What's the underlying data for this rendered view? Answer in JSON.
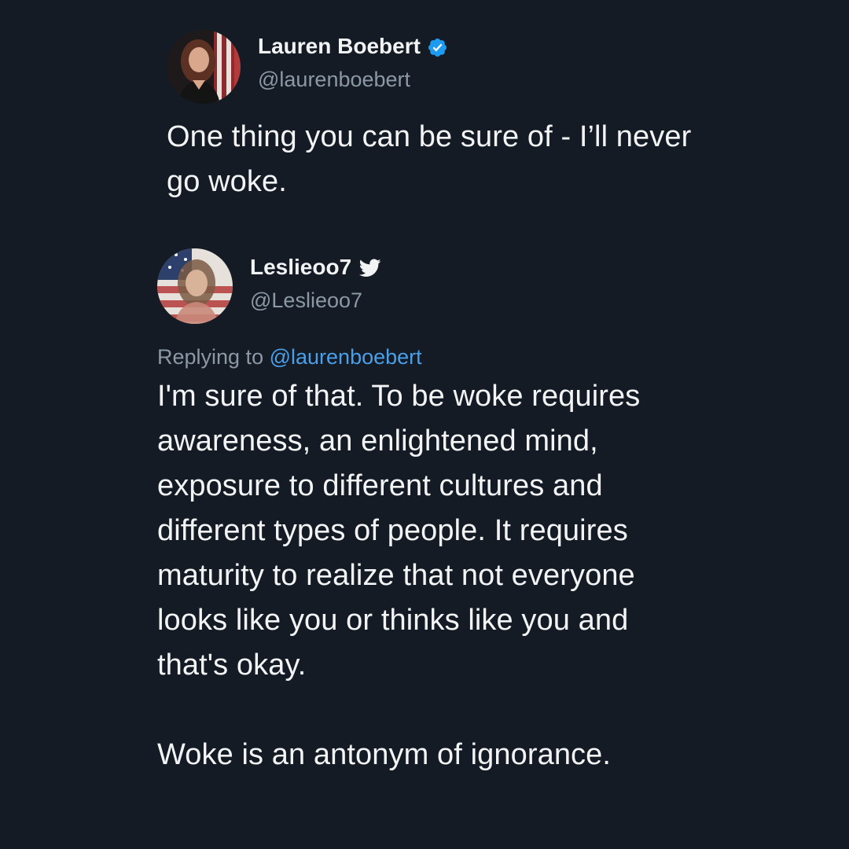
{
  "tweet_original": {
    "display_name": "Lauren Boebert",
    "handle": "@laurenboebert",
    "verified_icon": "verified-badge-icon",
    "text": "One thing you can be sure of - I’ll never go woke."
  },
  "tweet_reply": {
    "display_name": "Leslieoo7",
    "handle": "@Leslieoo7",
    "name_icon": "twitter-bird-icon",
    "replying_prefix": "Replying to",
    "replying_to": "@laurenboebert",
    "text_paragraph_1": "I'm sure of that. To be woke requires awareness, an enlightened mind, exposure to different cultures and different types of people. It requires maturity to realize that not everyone looks like you or thinks like you and that's okay.",
    "text_paragraph_2": "Woke is an antonym of ignorance."
  },
  "colors": {
    "background": "#141b24",
    "primary_text": "#f3f4f5",
    "secondary_text": "#8b98a5",
    "link": "#4a9fe8",
    "verified": "#1d9bf0"
  }
}
